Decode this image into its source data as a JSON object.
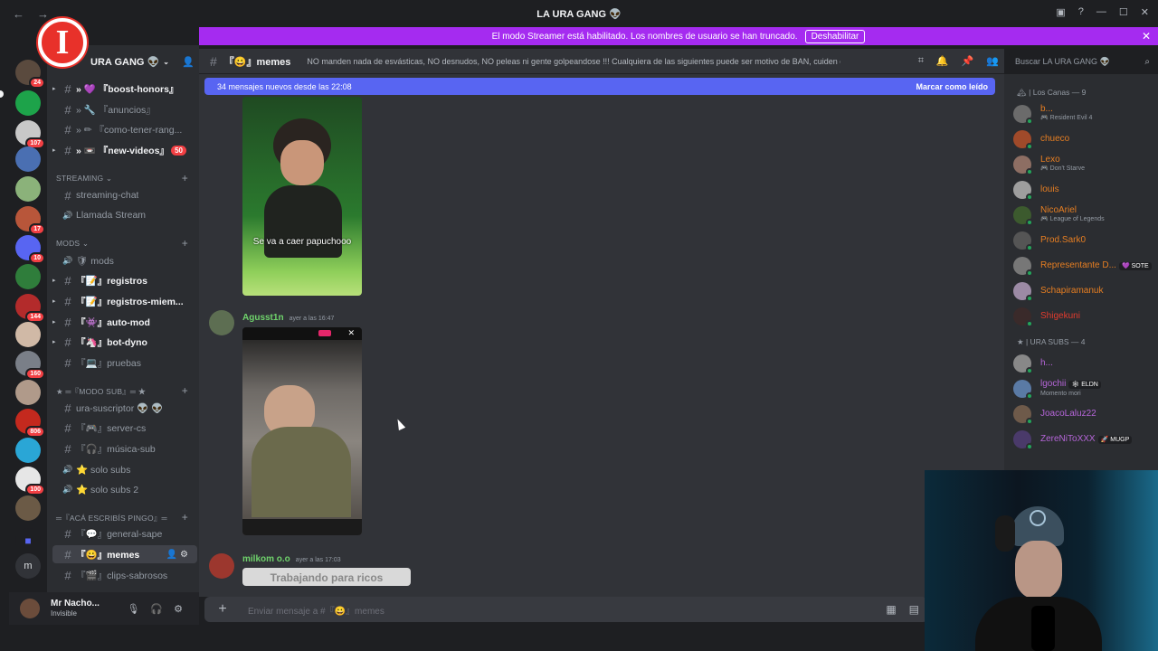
{
  "window": {
    "title": "LA URA GANG 👽"
  },
  "streamer": {
    "text": "El modo Streamer está habilitado. Los nombres de usuario se han truncado.",
    "button": "Deshabilitar"
  },
  "server": {
    "name": "URA GANG 👽",
    "logo_letter": "I"
  },
  "rail_badges": [
    "24",
    "107",
    "17",
    "10",
    "144",
    "160",
    "806",
    "100"
  ],
  "channels": [
    {
      "type": "text",
      "label": "» 💜 『boost-honors』",
      "unread": true
    },
    {
      "type": "text",
      "label": "» 🔧 『anuncios』",
      "unread": false
    },
    {
      "type": "text",
      "label": "» ✏ 『como-tener-rang...",
      "unread": false
    },
    {
      "type": "text",
      "label": "» 📼 『new-videos』",
      "unread": true,
      "count": "50"
    },
    {
      "type": "category",
      "label": "STREAMING ⌄"
    },
    {
      "type": "text",
      "label": "streaming-chat",
      "unread": false
    },
    {
      "type": "voice",
      "label": "Llamada Stream",
      "unread": false
    },
    {
      "type": "category",
      "label": "mods ⌄"
    },
    {
      "type": "voice",
      "label": "🛡 mods",
      "unread": false
    },
    {
      "type": "text",
      "label": "『📝』registros",
      "unread": true
    },
    {
      "type": "text",
      "label": "『📝』registros-miem...",
      "unread": true
    },
    {
      "type": "text",
      "label": "『👾』auto-mod",
      "unread": true
    },
    {
      "type": "text",
      "label": "『🦄』bot-dyno",
      "unread": true
    },
    {
      "type": "text",
      "label": "『💻』pruebas",
      "unread": false
    },
    {
      "type": "category",
      "label": "★ ═『MODO SUB』═ ★"
    },
    {
      "type": "text",
      "label": "ura-suscriptor 👽 👽",
      "unread": false
    },
    {
      "type": "text",
      "label": "『🎮』server-cs",
      "unread": false
    },
    {
      "type": "text",
      "label": "『🎧』música-sub",
      "unread": false
    },
    {
      "type": "voice",
      "label": "⭐ solo subs",
      "unread": false
    },
    {
      "type": "voice",
      "label": "⭐ solo subs 2",
      "unread": false
    },
    {
      "type": "category",
      "label": "═『acá escribís pingo』═"
    },
    {
      "type": "text",
      "label": "『💬』general-sape",
      "unread": false
    },
    {
      "type": "text",
      "label": "『😀』memes",
      "unread": false,
      "selected": true
    },
    {
      "type": "text",
      "label": "『🎬』clips-sabrosos",
      "unread": false
    }
  ],
  "user": {
    "name": "Mr Nacho...",
    "status": "Invisible"
  },
  "topbar": {
    "channel": "『😀』memes",
    "topic": "NO manden nada de esvásticas, NO desnudos, NO peleas ni gente golpeandose !!! Cualquiera de las siguientes puede ser motivo de BAN, cuiden el stream!"
  },
  "search": {
    "placeholder": "Buscar LA URA GANG 👽"
  },
  "newbar": {
    "text": "34 mensajes nuevos desde las 22:08",
    "action": "Marcar como leído"
  },
  "messages": [
    {
      "caption": "Se va a caer papuchooo"
    },
    {
      "author": "Agusst1n",
      "time": "ayer a las 16:47"
    },
    {
      "author": "milkom o.o",
      "time": "ayer a las 17:03",
      "preview": "Trabajando para ricos"
    }
  ],
  "composer": {
    "placeholder": "Enviar mensaje a #『😀』memes"
  },
  "members": {
    "groups": [
      {
        "label": "🏔 | Los Canas — 9",
        "items": [
          {
            "name": "b...",
            "activity": "🎮 Resident Evil 4",
            "color": "#e67e22"
          },
          {
            "name": "chueco",
            "activity": "",
            "color": "#e67e22"
          },
          {
            "name": "Lexo",
            "activity": "🎮 Don't Starve",
            "color": "#e67e22"
          },
          {
            "name": "louis",
            "activity": "",
            "color": "#e67e22"
          },
          {
            "name": "NicoAriel",
            "activity": "🎮 League of Legends",
            "color": "#e67e22"
          },
          {
            "name": "Prod.Sark0",
            "activity": "",
            "color": "#e67e22"
          },
          {
            "name": "Representante D...",
            "activity": "",
            "color": "#e67e22",
            "tag": "💜 SOTE"
          },
          {
            "name": "Schapiramanuk",
            "activity": "",
            "color": "#e67e22"
          },
          {
            "name": "Shigekuni",
            "activity": "",
            "color": "#e33b2e"
          }
        ]
      },
      {
        "label": "★ | URA SUBS — 4",
        "items": [
          {
            "name": "h...",
            "activity": "",
            "color": "#b565d8"
          },
          {
            "name": "lgochii",
            "activity": "Momento mori",
            "color": "#b565d8",
            "tag": "🕸 ELDN"
          },
          {
            "name": "JoacoLaluz22",
            "activity": "",
            "color": "#b565d8"
          },
          {
            "name": "ZereNiToXXX",
            "activity": "",
            "color": "#b565d8",
            "tag": "🚀 MUGP"
          }
        ]
      }
    ]
  }
}
